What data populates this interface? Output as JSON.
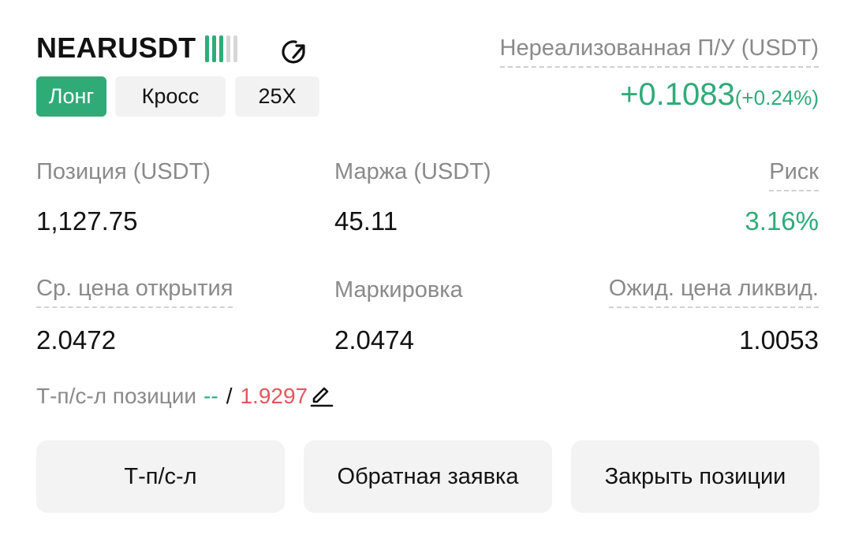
{
  "colors": {
    "accent_green": "#2fab78",
    "loss_red": "#e0575f",
    "muted_text": "#8a8a8a",
    "bar_active": "#2fab78",
    "bar_inactive": "#d6d6d6"
  },
  "header": {
    "symbol": "NEARUSDT",
    "strength_bars": {
      "active": 3,
      "total": 5
    },
    "share_icon": "share-icon",
    "tags": {
      "side": "Лонг",
      "margin_mode": "Кросс",
      "leverage": "25X"
    },
    "unrealized_pnl": {
      "label": "Нереализованная П/У (USDT)",
      "value": "+0.1083",
      "percent": "(+0.24%)"
    }
  },
  "stats": {
    "position_label": "Позиция (USDT)",
    "position_value": "1,127.75",
    "margin_label": "Маржа (USDT)",
    "margin_value": "45.11",
    "risk_label": "Риск",
    "risk_value": "3.16%",
    "entry_label": "Ср. цена открытия",
    "entry_value": "2.0472",
    "mark_label": "Маркировка",
    "mark_value": "2.0474",
    "liq_label": "Ожид. цена ликвид.",
    "liq_value": "1.0053"
  },
  "tpsl": {
    "label": "Т-п/с-л позиции",
    "tp_value": "--",
    "separator": "/",
    "sl_value": "1.9297",
    "edit_icon": "edit-icon"
  },
  "buttons": {
    "tpsl": "Т-п/с-л",
    "reverse": "Обратная заявка",
    "close": "Закрыть позиции"
  }
}
